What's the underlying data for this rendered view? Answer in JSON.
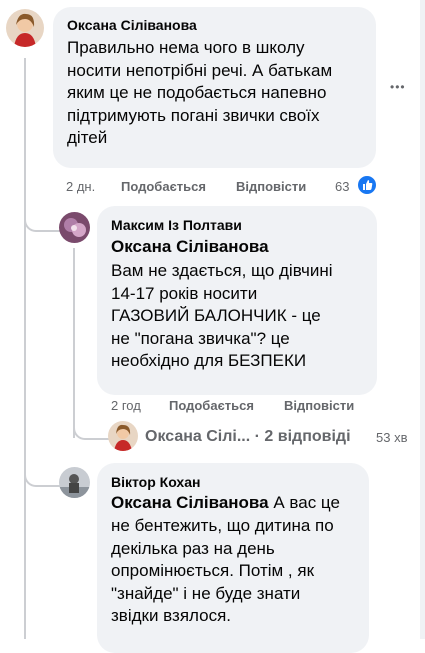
{
  "comments": [
    {
      "author": "Оксана Сіліванова",
      "text": "Правильно нема чого в школу\nносити непотрібні речі. А батькам\nяким це не подобається напевно\nпідтримують погані звички своїх\nдітей",
      "time": "2 дн.",
      "like": "Подобається",
      "reply": "Відповісти",
      "reactions": "63",
      "colors": {
        "reaction_badge": "#1877f2"
      }
    },
    {
      "author": "Максим Із Полтави",
      "mention": "Оксана Сіліванова",
      "text": "Вам не здається, що дівчині\n14-17 років носити\nГАЗОВИЙ БАЛОНЧИК - це\nне \"погана звичка\"? це\nнеобхідно для БЕЗПЕКИ",
      "time": "2 год",
      "like": "Подобається",
      "reply": "Відповісти"
    },
    {
      "author": "Віктор Кохан",
      "mention": "Оксана Сіліванова",
      "text_first": "А вас це",
      "text": "не бентежить, що дитина по\nдекілька раз на день\nопромінюється. Потім , як\n\"знайде\" і не буде знати\nзвідки взялося."
    }
  ],
  "replies_summary": {
    "name": "Оксана Сілі...",
    "separator": "·",
    "count": "2 відповіді",
    "time": "53 хв"
  },
  "more_icon": "•••"
}
